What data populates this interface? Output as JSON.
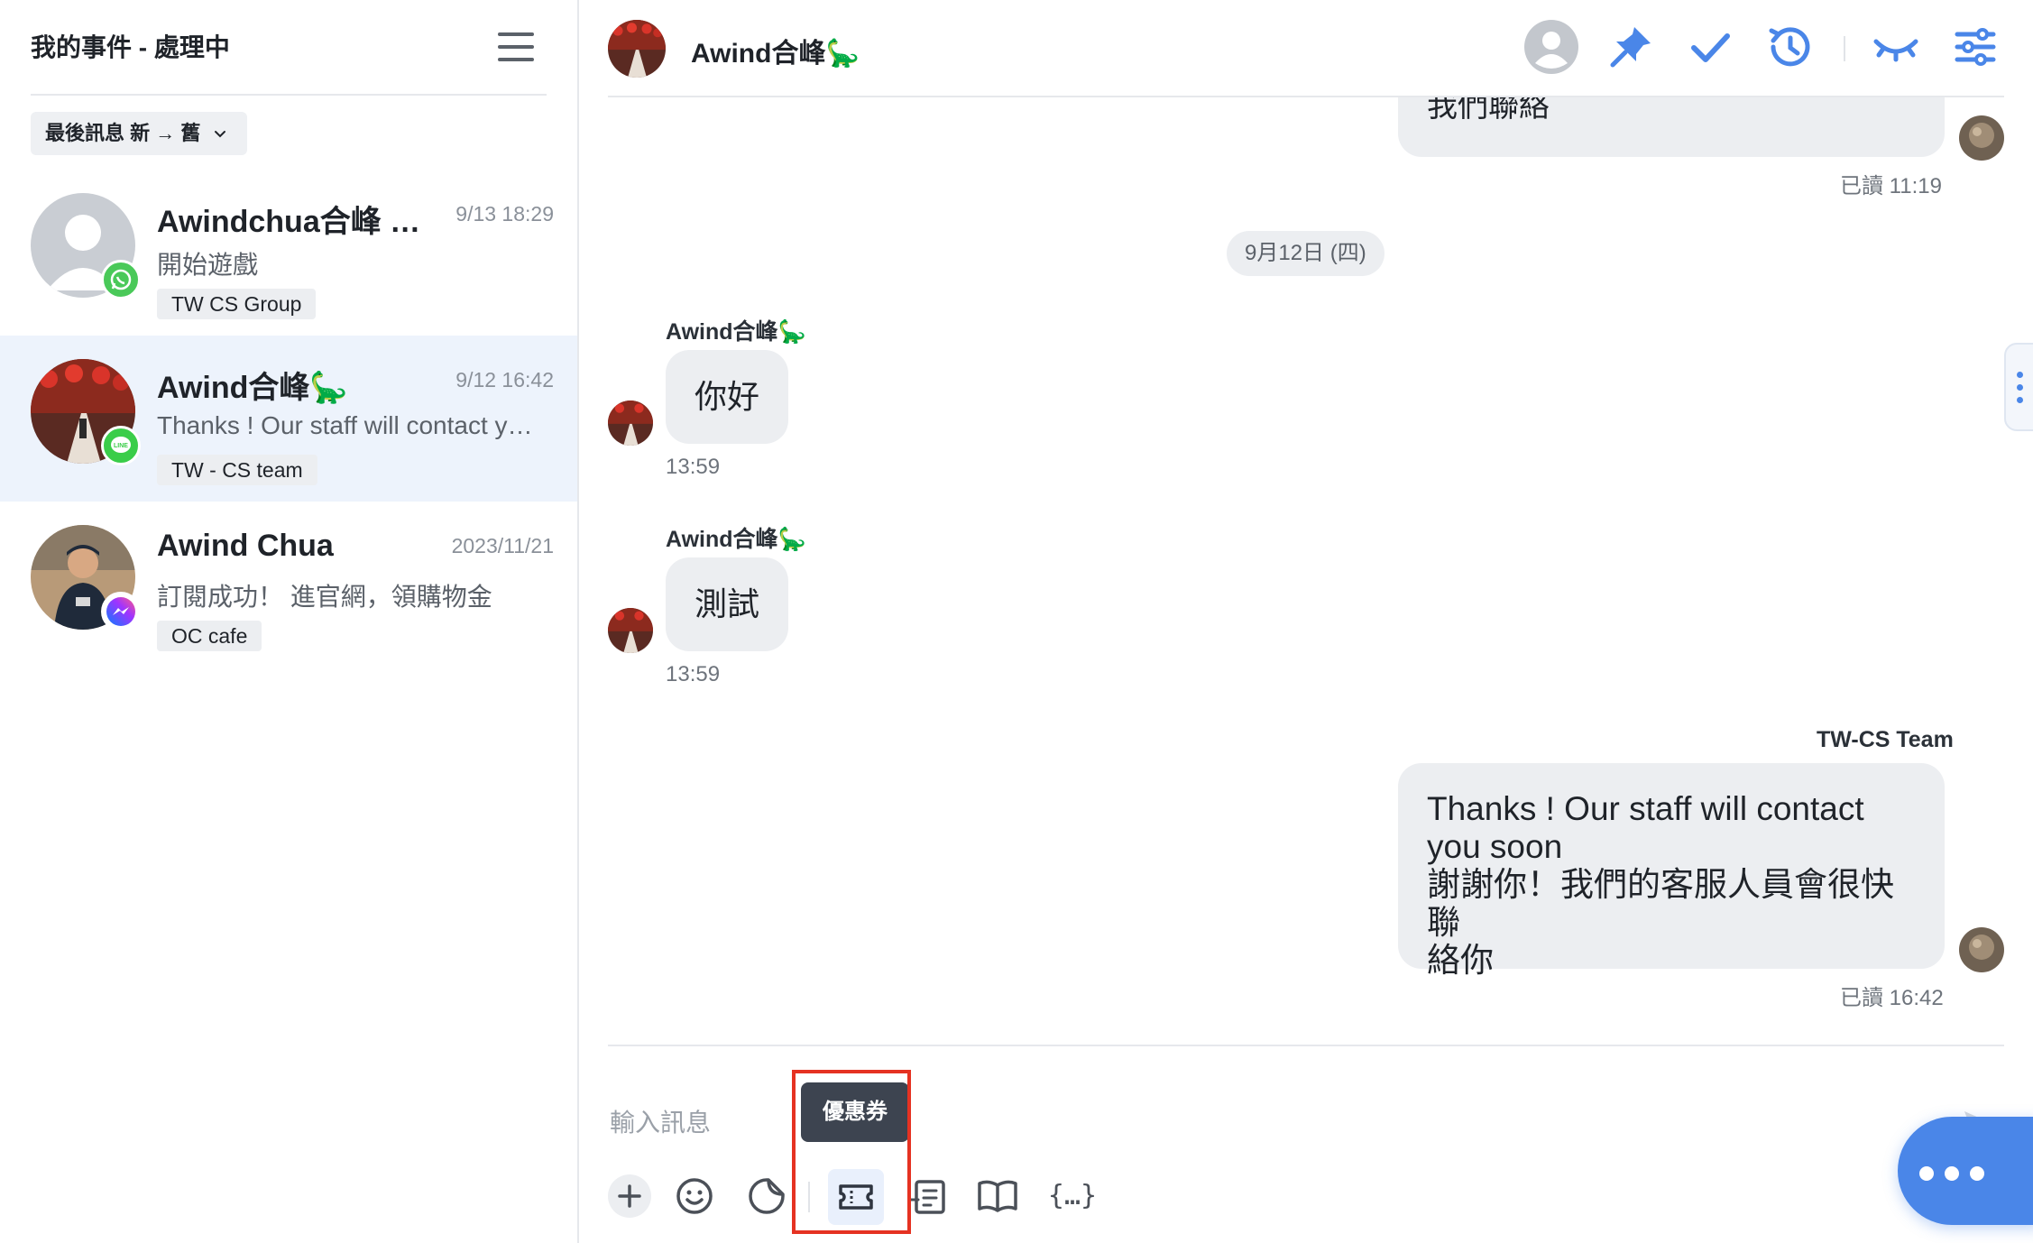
{
  "sidebar": {
    "title": "我的事件 - 處理中",
    "sort_label": "最後訊息 新 → 舊",
    "conversations": [
      {
        "name": "Awindchua合峰 …",
        "time": "9/13 18:29",
        "snippet": "開始遊戲",
        "tag": "TW CS Group",
        "channel": "whatsapp-icon",
        "active": false
      },
      {
        "name": "Awind合峰🦕",
        "time": "9/12 16:42",
        "snippet": "Thanks ! Our staff will contact y…",
        "tag": "TW - CS team",
        "channel": "line-icon",
        "active": true
      },
      {
        "name": "Awind Chua",
        "time": "2023/11/21",
        "snippet": "訂閱成功！ 進官網，領購物金",
        "tag": "OC cafe",
        "channel": "messenger-icon",
        "active": false
      }
    ]
  },
  "header": {
    "contact_name": "Awind合峰🦕",
    "tools": [
      "assign-user-icon",
      "pin-icon",
      "resolve-check-icon",
      "history-icon",
      "hide-eye-icon",
      "settings-sliders-icon"
    ]
  },
  "messages": {
    "top_partial_text": "我們聯絡",
    "top_read_receipt": "已讀 11:19",
    "date_divider": "9月12日 (四)",
    "incoming": [
      {
        "sender": "Awind合峰🦕",
        "text": "你好",
        "time": "13:59"
      },
      {
        "sender": "Awind合峰🦕",
        "text": "測試",
        "time": "13:59"
      }
    ],
    "outgoing": {
      "sender": "TW-CS Team",
      "line1": "Thanks ! Our staff will contact",
      "line2": "you soon",
      "line3": "謝謝你！我們的客服人員會很快聯",
      "line4": "絡你",
      "read_receipt": "已讀 16:42"
    }
  },
  "composer": {
    "placeholder": "輸入訊息",
    "tooltip": "優惠券",
    "variable_label": "{…}",
    "tools": [
      "add-icon",
      "emoji-icon",
      "sticker-icon",
      "coupon-icon",
      "form-icon",
      "knowledge-book-icon",
      "variable-icon"
    ]
  },
  "colors": {
    "accent": "#4a86e8",
    "active_row": "#edf3fc",
    "bubble": "#eceef1",
    "highlight": "#e53222",
    "whatsapp": "#4ac959",
    "line": "#3acd49",
    "messenger": "#8b5cf6"
  }
}
